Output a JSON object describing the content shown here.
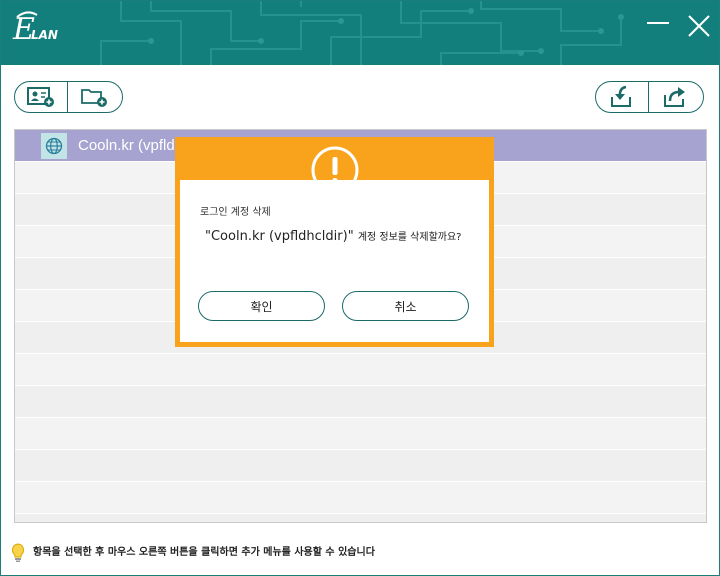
{
  "app": {
    "logo_text": "ELAN",
    "brand_color": "#137f7c"
  },
  "window_controls": {
    "minimize_icon": "minimize-icon",
    "close_icon": "close-icon"
  },
  "toolbar": {
    "left_buttons": [
      "add-account-icon",
      "add-folder-icon"
    ],
    "right_buttons": [
      "import-icon",
      "export-icon"
    ]
  },
  "accounts": {
    "items": [
      {
        "label": "Cooln.kr (vpfldhcldir)",
        "icon": "globe-icon",
        "selected": true
      }
    ]
  },
  "dialog": {
    "heading": "로그인 계정 삭제",
    "message_account": "\"Cooln.kr (vpfldhcldir)\"",
    "message_text": "계정 정보를 삭제할까요?",
    "confirm_label": "확인",
    "cancel_label": "취소",
    "accent_color": "#f9a31c"
  },
  "status": {
    "tip": "항목을 선택한 후 마우스 오른쪽 버튼을 클릭하면 추가 메뉴를 사용할 수 있습니다"
  }
}
